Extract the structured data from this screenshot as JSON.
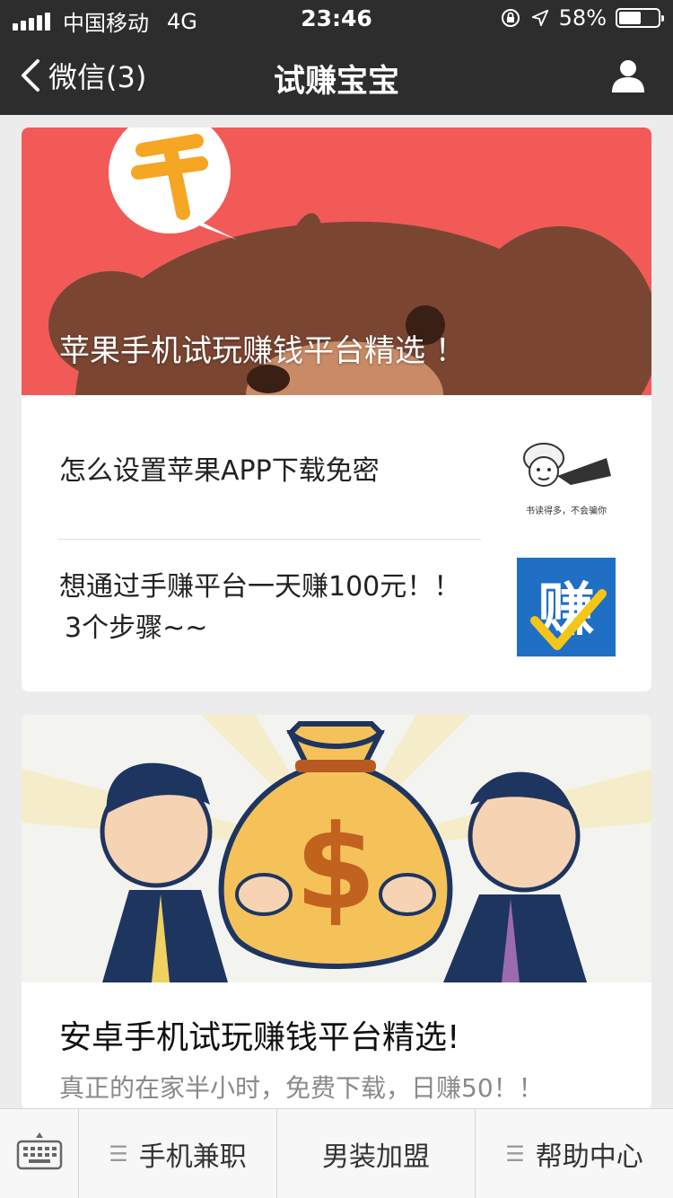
{
  "status_bar": {
    "carrier": "中国移动",
    "network": "4G",
    "time": "23:46",
    "battery_text": "58%",
    "battery_level": 0.58
  },
  "nav": {
    "back_label": "微信(3)",
    "title": "试赚宝宝",
    "user_icon": "person-icon"
  },
  "card1": {
    "hero_title": "苹果手机试玩赚钱平台精选 ！",
    "items": [
      {
        "title": "怎么设置苹果APP下载免密",
        "thumb_caption": "书读得多，不会骗你"
      },
      {
        "title_line1": "想通过手赚平台一天赚100元！！",
        "title_line2": "3个步骤~~",
        "thumb_char": "赚"
      }
    ]
  },
  "card2": {
    "hero_symbol": "$",
    "title": "安卓手机试玩赚钱平台精选!",
    "subtitle": "真正的在家半小时，免费下载，日赚50！！"
  },
  "bottom_menu": {
    "keyboard_icon": "keyboard-icon",
    "items": [
      "手机兼职",
      "男装加盟",
      "帮助中心"
    ]
  },
  "colors": {
    "bar_bg": "#2d2d2d",
    "hero1_bg": "#f25a58",
    "bear_brown": "#7a4632",
    "coin_orange": "#f5a623",
    "blue_thumb": "#1f6fc4"
  }
}
